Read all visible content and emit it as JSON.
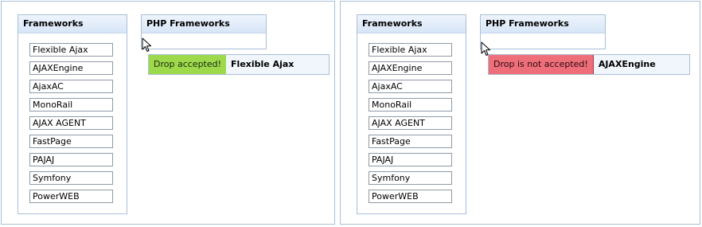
{
  "left_demo": {
    "source": {
      "title": "Frameworks",
      "items": [
        "Flexible Ajax",
        "AJAXEngine",
        "AjaxAC",
        "MonoRail",
        "AJAX AGENT",
        "FastPage",
        "PAJAJ",
        "Symfony",
        "PowerWEB"
      ]
    },
    "target": {
      "title": "PHP Frameworks"
    },
    "drag": {
      "status": "Drop accepted!",
      "item": "Flexible Ajax",
      "status_color": "#9dd94b"
    }
  },
  "right_demo": {
    "source": {
      "title": "Frameworks",
      "items": [
        "Flexible Ajax",
        "AJAXEngine",
        "AjaxAC",
        "MonoRail",
        "AJAX AGENT",
        "FastPage",
        "PAJAJ",
        "Symfony",
        "PowerWEB"
      ]
    },
    "target": {
      "title": "PHP Frameworks"
    },
    "drag": {
      "status": "Drop is not accepted!",
      "item": "AJAXEngine",
      "status_color": "#ee6e7a"
    }
  }
}
